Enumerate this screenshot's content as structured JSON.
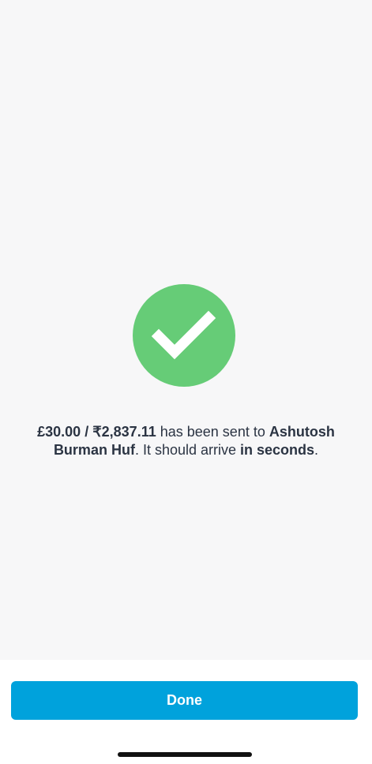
{
  "confirmation": {
    "amount": "£30.00 / ₹2,837.11",
    "sent_text": " has been sent to ",
    "recipient": "Ashutosh Burman Huf",
    "arrival_text": ". It should arrive ",
    "arrival_time": "in seconds",
    "period": "."
  },
  "actions": {
    "done_label": "Done"
  },
  "icons": {
    "success": "checkmark-icon"
  },
  "colors": {
    "success": "#66cc77",
    "primary": "#00a2dc",
    "text": "#2b3443",
    "background": "#f7f7f8",
    "footer_background": "#ffffff"
  }
}
